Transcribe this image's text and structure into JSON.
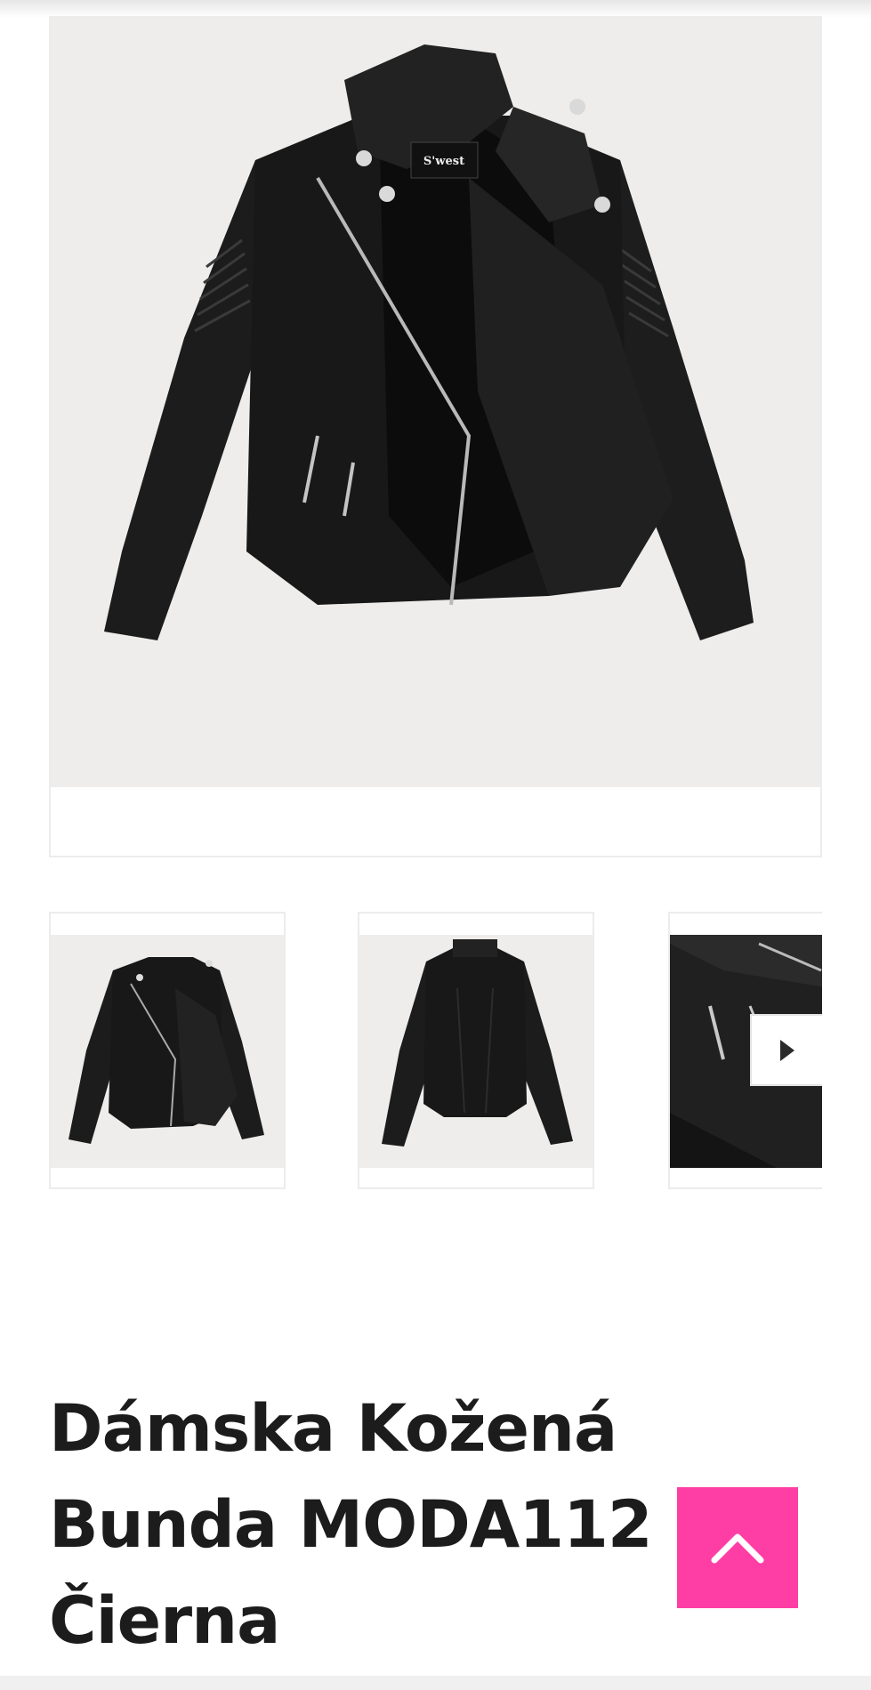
{
  "product": {
    "title_lines": [
      "Dámska Kožená",
      "Bunda MODA112",
      "Čierna"
    ],
    "main_image_alt": "Dámska kožená bunda MODA112 čierna",
    "brand_tag_text": "S'west"
  },
  "gallery": {
    "thumbnails": [
      {
        "alt": "Front view"
      },
      {
        "alt": "Back view"
      },
      {
        "alt": "Detail view"
      }
    ],
    "next_icon": "chevron-right-icon"
  },
  "scroll_top": {
    "icon": "chevron-up-icon"
  },
  "colors": {
    "accent": "#ff3ea5",
    "title": "#1c1c1c",
    "photo_bg": "#eeedec"
  }
}
